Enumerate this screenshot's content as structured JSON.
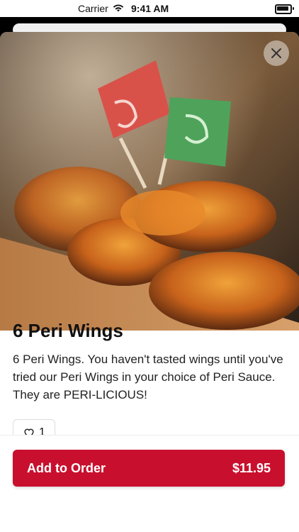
{
  "status_bar": {
    "carrier": "Carrier",
    "time": "9:41 AM"
  },
  "product": {
    "title": "6 Peri Wings",
    "description": "6 Peri Wings. You haven't tasted wings until you've tried our Peri Wings in your choice of Peri Sauce. They are PERI-LICIOUS!",
    "image_icon": "food-photo",
    "like_count": "1"
  },
  "actions": {
    "add_label": "Add to Order",
    "price": "$11.95"
  },
  "colors": {
    "accent": "#c8102e"
  }
}
